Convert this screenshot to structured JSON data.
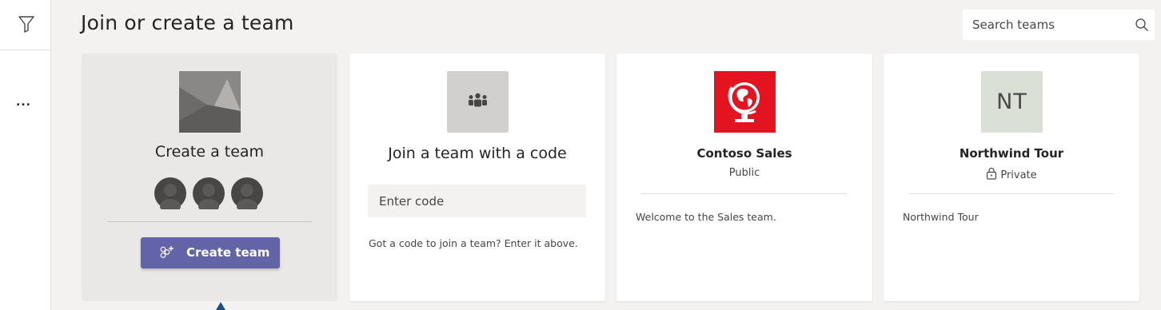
{
  "header": {
    "title": "Join or create a team",
    "search_placeholder": "Search teams"
  },
  "left_rail": {
    "filter_icon": "filter-icon",
    "more_label": "..."
  },
  "create_card": {
    "heading": "Create a team",
    "button_label": "Create team",
    "button_icon": "add-people-icon",
    "accent_color": "#6264a7"
  },
  "join_card": {
    "heading": "Join a team with a code",
    "input_placeholder": "Enter code",
    "hint": "Got a code to join a team? Enter it above.",
    "icon": "teams-icon"
  },
  "teams": [
    {
      "name": "Contoso Sales",
      "privacy": "Public",
      "description": "Welcome to the Sales team.",
      "logo": "globe-logo",
      "logo_color": "#e3141f"
    },
    {
      "name": "Northwind Tour",
      "privacy": "Private",
      "description": "Northwind Tour",
      "initials": "NT",
      "logo_color": "#dbe0d6"
    }
  ]
}
